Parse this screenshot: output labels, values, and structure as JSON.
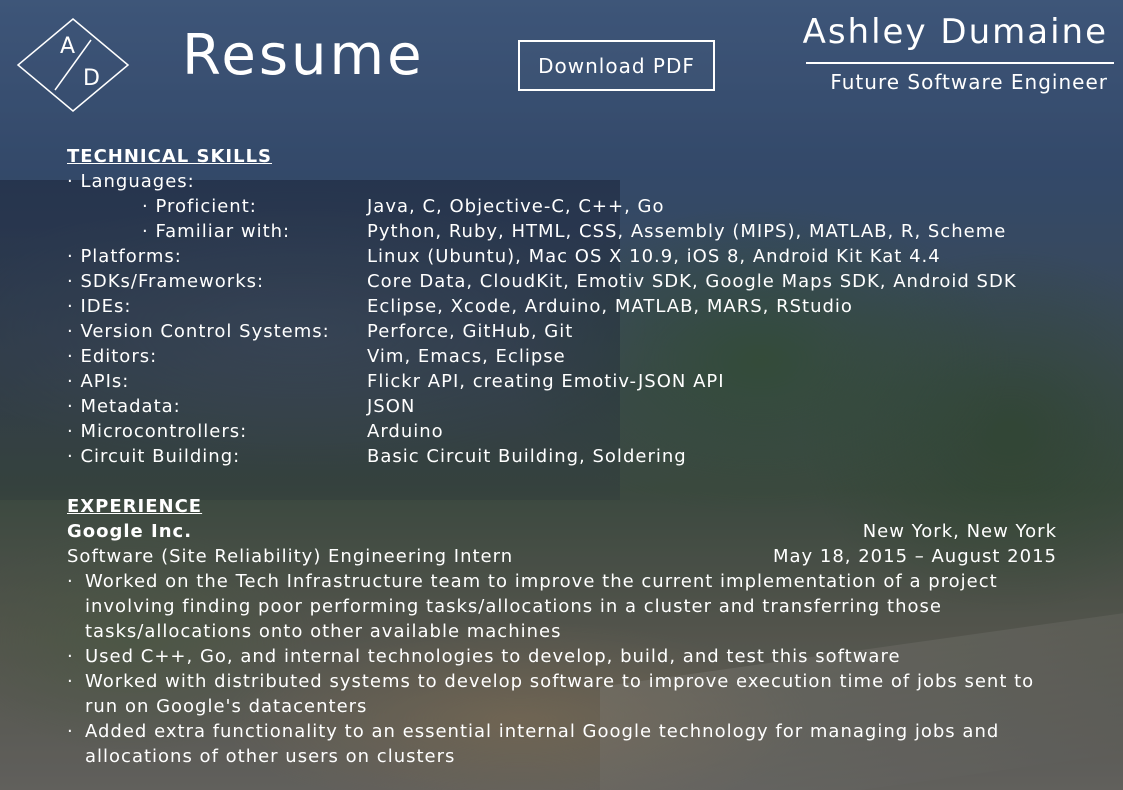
{
  "header": {
    "logo_letters": {
      "top": "A",
      "bottom": "D"
    },
    "title": "Resume",
    "download_label": "Download PDF",
    "name": "Ashley Dumaine",
    "subtitle": "Future Software Engineer"
  },
  "technical_skills": {
    "heading": "TECHNICAL SKILLS",
    "languages_label": "· Languages:",
    "languages": [
      {
        "label": "· Proficient:",
        "value": "Java, C, Objective-C, C++, Go"
      },
      {
        "label": "· Familiar with:",
        "value": "Python, Ruby, HTML, CSS, Assembly (MIPS), MATLAB, R, Scheme"
      }
    ],
    "rows": [
      {
        "label": "· Platforms:",
        "value": "Linux (Ubuntu), Mac OS X 10.9, iOS 8, Android Kit Kat 4.4"
      },
      {
        "label": "· SDKs/Frameworks:",
        "value": "Core Data, CloudKit, Emotiv SDK, Google Maps SDK, Android SDK"
      },
      {
        "label": "· IDEs:",
        "value": "Eclipse, Xcode, Arduino, MATLAB, MARS, RStudio"
      },
      {
        "label": "· Version Control Systems:",
        "value": "Perforce, GitHub, Git"
      },
      {
        "label": "· Editors:",
        "value": "Vim, Emacs, Eclipse"
      },
      {
        "label": "· APIs:",
        "value": "Flickr API, creating Emotiv-JSON API"
      },
      {
        "label": "· Metadata:",
        "value": "JSON"
      },
      {
        "label": "· Microcontrollers:",
        "value": "Arduino"
      },
      {
        "label": "· Circuit Building:",
        "value": "Basic Circuit Building, Soldering"
      }
    ]
  },
  "experience": {
    "heading": "EXPERIENCE",
    "company": "Google Inc.",
    "location": "New York, New York",
    "role": "Software (Site Reliability) Engineering Intern",
    "dates": "May 18, 2015 – August 2015",
    "bullet_marker": "·",
    "bullets": [
      "Worked on the Tech Infrastructure team to improve the current implementation of a project involving finding poor performing tasks/allocations in a cluster and transferring those tasks/allocations onto other available machines",
      "Used C++, Go, and internal technologies to develop, build, and test this software",
      "Worked with distributed systems to develop software to improve execution time of jobs sent to run on Google's datacenters",
      "Added extra functionality to an essential internal Google technology for managing jobs and allocations of other users on clusters"
    ]
  },
  "colors": {
    "text": "#ffffff",
    "sky": "#4e6c96",
    "foliage": "#4a5a46"
  }
}
